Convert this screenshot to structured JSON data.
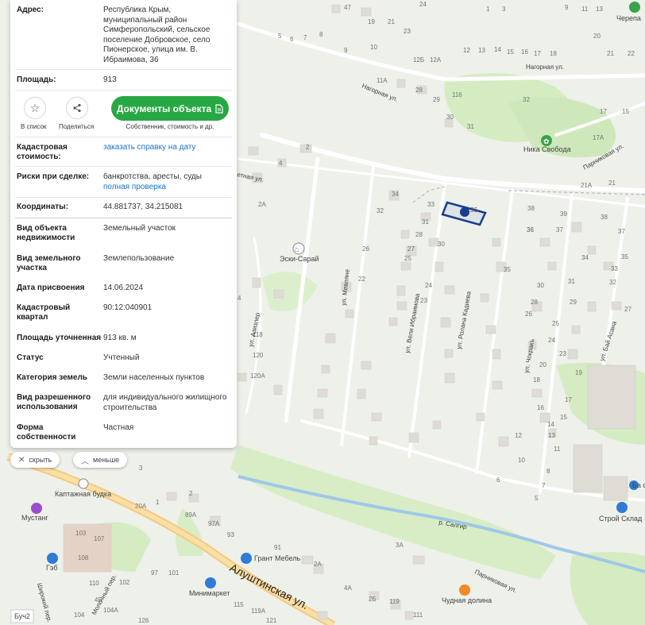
{
  "panel": {
    "address_key": "Адрес:",
    "address_val": "Республика Крым, муниципальный район Симферопольский, сельское поселение Добровское, село Пионерское, улица им. В. Ибраимова, 36",
    "area_key": "Площадь:",
    "area_val": "913",
    "add_list_label": "В список",
    "share_label": "Поделиться",
    "docs_button": "Документы объекта",
    "docs_sub": "Собственник, стоимость и др.",
    "cadastral_cost_key": "Кадастровая стоимость:",
    "cadastral_cost_link": "заказать справку на дату",
    "risks_key": "Риски при сделке:",
    "risks_val": "банкротства, аресты, суды",
    "risks_link": "полная проверка",
    "coords_key": "Координаты:",
    "coords_val": "44.881737, 34.215081",
    "obj_type_key": "Вид объекта недвижимости",
    "obj_type_val": "Земельный участок",
    "land_type_key": "Вид земельного участка",
    "land_type_val": "Землепользование",
    "reg_date_key": "Дата присвоения",
    "reg_date_val": "14.06.2024",
    "quarter_key": "Кадастровый квартал",
    "quarter_val": "90:12:040901",
    "precise_area_key": "Площадь уточненная",
    "precise_area_val": "913 кв. м",
    "status_key": "Статус",
    "status_val": "Учтенный",
    "category_key": "Категория земель",
    "category_val": "Земли населенных пунктов",
    "usage_key": "Вид разрешенного использования",
    "usage_val": "для индивидуального жилищного строительства",
    "ownership_key": "Форма собственности",
    "ownership_val": "Частная"
  },
  "controls": {
    "hide_label": "скрыть",
    "less_label": "меньше"
  },
  "map": {
    "streets": {
      "nagornaya_top": "Нагорная ул.",
      "nagornaya_mid": "Нагорная ул.",
      "parnikovaya_top": "Парниковая ул.",
      "parnikovaya_bottom": "Парниковая ул.",
      "metnaya": "етная ул.",
      "aziler": "ул. Азизлер",
      "mevlyane": "ул. Мевляне",
      "veli": "ул. Вели Ибраимова",
      "rolana": "ул. Ролана Кадиева",
      "chokrak": "ул. Чокракъ",
      "bay_asan": "ул. Бай Асана",
      "alushtinskaya": "Алуштинская ул.",
      "molochny": "Молочный пер.",
      "shirokiy": "Широкий пер.",
      "salgir": "р. Салгир"
    },
    "pois": {
      "eski_saray": "Эски-Сарай",
      "nika": "Ника Свобода",
      "kaptazh": "Каптажная будка",
      "mustang": "Мустанг",
      "geb": "Гэб",
      "grant": "Грант Мебель",
      "minimarket": "Минимаркет",
      "chudnaya": "Чудная долина",
      "stroy": "Строй Склад",
      "cherepa": "Черепа",
      "ba_st": "Ба ст",
      "buch": "Буч2"
    },
    "house_numbers": [
      "47",
      "24",
      "1",
      "3",
      "9",
      "11",
      "13",
      "19",
      "21",
      "23",
      "5",
      "6",
      "7",
      "8",
      "9",
      "10",
      "20",
      "12",
      "13",
      "14",
      "15",
      "16",
      "17",
      "18",
      "21",
      "22",
      "12Б",
      "12А",
      "11А",
      "28",
      "116",
      "29",
      "30",
      "31",
      "32",
      "17",
      "15",
      "17А",
      "2",
      "4",
      "21А",
      "21",
      "2А",
      "34",
      "33",
      "32",
      "31",
      "36",
      "30",
      "35",
      "28",
      "27",
      "26",
      "25",
      "24",
      "23",
      "22",
      "38",
      "39",
      "36",
      "37",
      "38",
      "37",
      "35",
      "34",
      "33",
      "32",
      "31",
      "30",
      "29",
      "28",
      "27",
      "26",
      "25",
      "24",
      "23",
      "20",
      "19",
      "18",
      "17",
      "16",
      "15",
      "14",
      "13",
      "12",
      "11",
      "10",
      "8",
      "7",
      "6",
      "5",
      "4",
      "3",
      "2",
      "1",
      "20А",
      "89А",
      "97А",
      "93",
      "91",
      "97",
      "101",
      "103",
      "107",
      "108",
      "110",
      "102",
      "104А",
      "104",
      "4Б",
      "3А",
      "2А",
      "4А",
      "2Б",
      "119",
      "111",
      "115",
      "119А",
      "121",
      "126",
      "118",
      "120",
      "120А",
      "110А",
      "6",
      "4",
      "2"
    ],
    "marker_label": "36"
  }
}
